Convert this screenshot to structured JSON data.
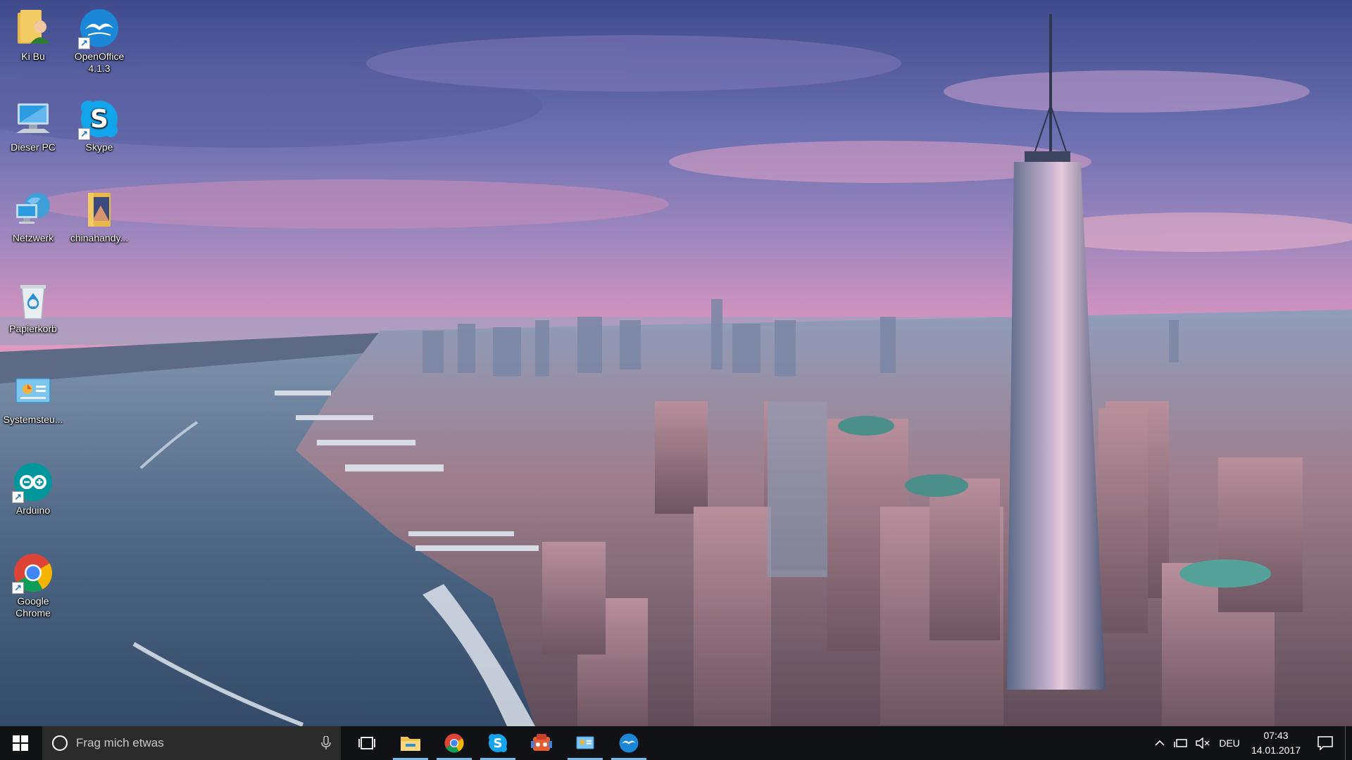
{
  "desktop": {
    "icons": [
      {
        "label": "Ki Bu",
        "icon": "user-folder-icon"
      },
      {
        "label": "OpenOffice 4.1.3",
        "icon": "openoffice-icon"
      },
      {
        "label": "Dieser PC",
        "icon": "computer-icon"
      },
      {
        "label": "Skype",
        "icon": "skype-icon"
      },
      {
        "label": "Netzwerk",
        "icon": "network-icon"
      },
      {
        "label": "chinahandy...",
        "icon": "folder-icon"
      },
      {
        "label": "Papierkorb",
        "icon": "recycle-bin-icon"
      },
      {
        "label": "Systemsteu...",
        "icon": "control-panel-icon"
      },
      {
        "label": "Arduino",
        "icon": "arduino-icon"
      },
      {
        "label": "Google Chrome",
        "icon": "chrome-icon"
      }
    ]
  },
  "taskbar": {
    "search_placeholder": "Frag mich etwas",
    "apps": [
      {
        "name": "task-view",
        "icon": "task-view-icon"
      },
      {
        "name": "file-explorer",
        "icon": "file-explorer-icon"
      },
      {
        "name": "chrome",
        "icon": "chrome-icon"
      },
      {
        "name": "skype",
        "icon": "skype-icon"
      },
      {
        "name": "program",
        "icon": "app-icon"
      },
      {
        "name": "control-panel",
        "icon": "control-panel-icon"
      },
      {
        "name": "openoffice",
        "icon": "openoffice-icon"
      }
    ],
    "tray": {
      "language": "DEU",
      "time": "07:43",
      "date": "14.01.2017"
    }
  },
  "colors": {
    "taskbar_bg": "#101216",
    "active_indicator": "#76b9ed"
  }
}
